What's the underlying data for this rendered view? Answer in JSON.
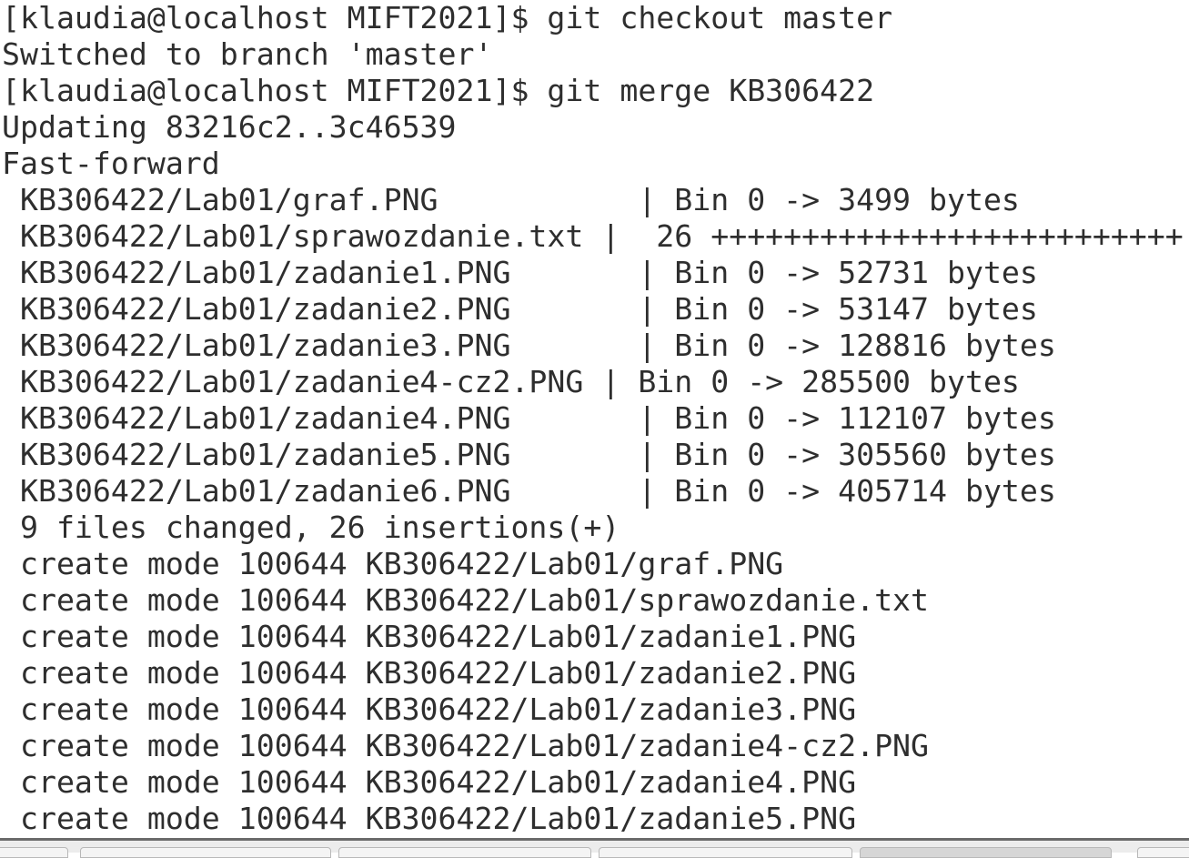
{
  "terminal": {
    "lines": [
      "[klaudia@localhost MIFT2021]$ git checkout master",
      "Switched to branch 'master'",
      "[klaudia@localhost MIFT2021]$ git merge KB306422",
      "Updating 83216c2..3c46539",
      "Fast-forward",
      " KB306422/Lab01/graf.PNG           | Bin 0 -> 3499 bytes",
      " KB306422/Lab01/sprawozdanie.txt |  26 ++++++++++++++++++++++++++",
      " KB306422/Lab01/zadanie1.PNG       | Bin 0 -> 52731 bytes",
      " KB306422/Lab01/zadanie2.PNG       | Bin 0 -> 53147 bytes",
      " KB306422/Lab01/zadanie3.PNG       | Bin 0 -> 128816 bytes",
      " KB306422/Lab01/zadanie4-cz2.PNG | Bin 0 -> 285500 bytes",
      " KB306422/Lab01/zadanie4.PNG       | Bin 0 -> 112107 bytes",
      " KB306422/Lab01/zadanie5.PNG       | Bin 0 -> 305560 bytes",
      " KB306422/Lab01/zadanie6.PNG       | Bin 0 -> 405714 bytes",
      " 9 files changed, 26 insertions(+)",
      " create mode 100644 KB306422/Lab01/graf.PNG",
      " create mode 100644 KB306422/Lab01/sprawozdanie.txt",
      " create mode 100644 KB306422/Lab01/zadanie1.PNG",
      " create mode 100644 KB306422/Lab01/zadanie2.PNG",
      " create mode 100644 KB306422/Lab01/zadanie3.PNG",
      " create mode 100644 KB306422/Lab01/zadanie4-cz2.PNG",
      " create mode 100644 KB306422/Lab01/zadanie4.PNG",
      " create mode 100644 KB306422/Lab01/zadanie5.PNG"
    ]
  },
  "tabs": {
    "active_index": 4
  }
}
